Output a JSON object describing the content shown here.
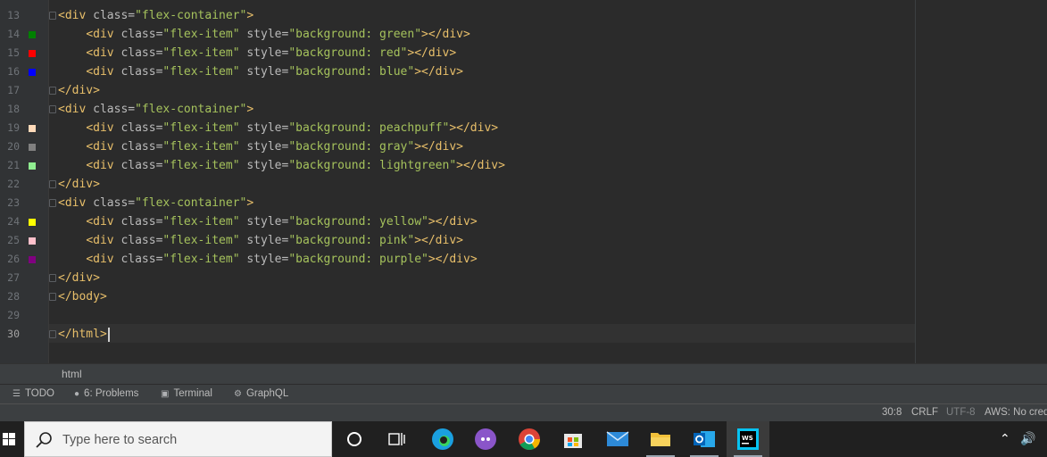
{
  "editor": {
    "lines": [
      {
        "n": "13",
        "html": "<span class='tag'>&lt;div </span><span class='attr'>class=</span><span class='str'>\"flex-container\"</span><span class='tag'>&gt;</span>"
      },
      {
        "n": "14",
        "swatch": "#008000",
        "html": "    <span class='tag'>&lt;div </span><span class='attr'>class=</span><span class='str'>\"flex-item\" </span><span class='attr'>style=</span><span class='str'>\"background: green\"</span><span class='tag'>&gt;&lt;/div&gt;</span>"
      },
      {
        "n": "15",
        "swatch": "#ff0000",
        "html": "    <span class='tag'>&lt;div </span><span class='attr'>class=</span><span class='str'>\"flex-item\" </span><span class='attr'>style=</span><span class='str'>\"background: red\"</span><span class='tag'>&gt;&lt;/div&gt;</span>"
      },
      {
        "n": "16",
        "swatch": "#0000ff",
        "html": "    <span class='tag'>&lt;div </span><span class='attr'>class=</span><span class='str'>\"flex-item\" </span><span class='attr'>style=</span><span class='str'>\"background: blue\"</span><span class='tag'>&gt;&lt;/div&gt;</span>"
      },
      {
        "n": "17",
        "html": "<span class='tag'>&lt;/div&gt;</span>"
      },
      {
        "n": "18",
        "html": "<span class='tag'>&lt;div </span><span class='attr'>class=</span><span class='str'>\"flex-container\"</span><span class='tag'>&gt;</span>"
      },
      {
        "n": "19",
        "swatch": "#ffdab9",
        "html": "    <span class='tag'>&lt;div </span><span class='attr'>class=</span><span class='str'>\"flex-item\" </span><span class='attr'>style=</span><span class='str'>\"background: peachpuff\"</span><span class='tag'>&gt;&lt;/div&gt;</span>"
      },
      {
        "n": "20",
        "swatch": "#808080",
        "html": "    <span class='tag'>&lt;div </span><span class='attr'>class=</span><span class='str'>\"flex-item\" </span><span class='attr'>style=</span><span class='str'>\"background: gray\"</span><span class='tag'>&gt;&lt;/div&gt;</span>"
      },
      {
        "n": "21",
        "swatch": "#90ee90",
        "html": "    <span class='tag'>&lt;div </span><span class='attr'>class=</span><span class='str'>\"flex-item\" </span><span class='attr'>style=</span><span class='str'>\"background: lightgreen\"</span><span class='tag'>&gt;&lt;/div&gt;</span>"
      },
      {
        "n": "22",
        "html": "<span class='tag'>&lt;/div&gt;</span>"
      },
      {
        "n": "23",
        "html": "<span class='tag'>&lt;div </span><span class='attr'>class=</span><span class='str'>\"flex-container\"</span><span class='tag'>&gt;</span>"
      },
      {
        "n": "24",
        "swatch": "#ffff00",
        "html": "    <span class='tag'>&lt;div </span><span class='attr'>class=</span><span class='str'>\"flex-item\" </span><span class='attr'>style=</span><span class='str'>\"background: yellow\"</span><span class='tag'>&gt;&lt;/div&gt;</span>"
      },
      {
        "n": "25",
        "swatch": "#ffc0cb",
        "html": "    <span class='tag'>&lt;div </span><span class='attr'>class=</span><span class='str'>\"flex-item\" </span><span class='attr'>style=</span><span class='str'>\"background: pink\"</span><span class='tag'>&gt;&lt;/div&gt;</span>"
      },
      {
        "n": "26",
        "swatch": "#800080",
        "html": "    <span class='tag'>&lt;div </span><span class='attr'>class=</span><span class='str'>\"flex-item\" </span><span class='attr'>style=</span><span class='str'>\"background: purple\"</span><span class='tag'>&gt;&lt;/div&gt;</span>"
      },
      {
        "n": "27",
        "html": "<span class='tag'>&lt;/div&gt;</span>"
      },
      {
        "n": "28",
        "html": "<span class='tag'>&lt;/body&gt;</span>"
      },
      {
        "n": "29",
        "html": ""
      },
      {
        "n": "30",
        "current": true,
        "html": "<span class='tag'>&lt;/html&gt;</span><span class='caret'></span>"
      }
    ]
  },
  "breadcrumb": "html",
  "tool_windows": {
    "todo": "TODO",
    "problems": "6: Problems",
    "terminal": "Terminal",
    "graphql": "GraphQL"
  },
  "status": {
    "position": "30:8",
    "line_sep": "CRLF",
    "encoding": "UTF-8",
    "aws": "AWS: No cred"
  },
  "taskbar": {
    "search_placeholder": "Type here to search",
    "apps": [
      "task-view",
      "edge",
      "chat-app",
      "chrome",
      "store",
      "mail",
      "file-explorer",
      "outlook",
      "webstorm"
    ]
  }
}
